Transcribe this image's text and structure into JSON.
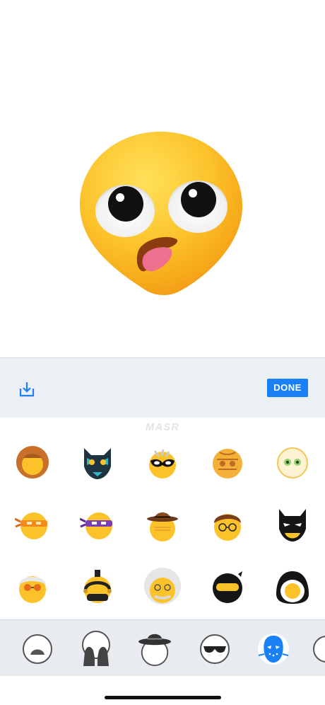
{
  "preview": {
    "face": "selected-emoji-face"
  },
  "toolbar": {
    "save_icon": "download-icon",
    "done_label": "DONE",
    "accent": "#1a80f5"
  },
  "watermark": "MASR",
  "grid": {
    "items": [
      {
        "name": "lion-mane-face"
      },
      {
        "name": "blue-tribal-mask-face"
      },
      {
        "name": "masquerade-mask-face"
      },
      {
        "name": "tiki-mask-face"
      },
      {
        "name": "pale-green-eyes-face"
      },
      {
        "name": "orange-bandana-ninja-face"
      },
      {
        "name": "purple-bandana-ninja-face"
      },
      {
        "name": "fedora-hat-face"
      },
      {
        "name": "harry-potter-face"
      },
      {
        "name": "batman-mask-face"
      },
      {
        "name": "white-hair-sunglasses-face"
      },
      {
        "name": "mohawk-helmet-face"
      },
      {
        "name": "einstein-hair-face"
      },
      {
        "name": "black-ninja-face"
      },
      {
        "name": "penguin-face"
      }
    ]
  },
  "categories": [
    {
      "name": "face-outline-icon"
    },
    {
      "name": "hands-icon"
    },
    {
      "name": "sombrero-icon"
    },
    {
      "name": "sunglasses-icon"
    },
    {
      "name": "hockey-mask-icon",
      "selected": true
    },
    {
      "name": "more-icon"
    }
  ]
}
